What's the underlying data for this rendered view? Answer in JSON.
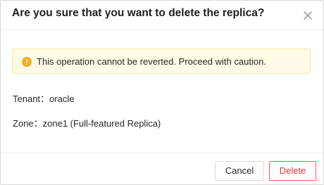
{
  "dialog": {
    "title": "Are you sure that you want to delete the replica?",
    "close_icon": "close-icon"
  },
  "alert": {
    "icon": "warning-icon",
    "text": "This operation cannot be reverted. Proceed with caution."
  },
  "details": {
    "tenant_label": "Tenant：oracle",
    "zone_label": "Zone：zone1 (Full-featured Replica)"
  },
  "footer": {
    "cancel_label": "Cancel",
    "delete_label": "Delete"
  },
  "colors": {
    "warning_icon": "#f5b01b",
    "alert_background": "#fffbe6",
    "danger": "#f0333a"
  }
}
